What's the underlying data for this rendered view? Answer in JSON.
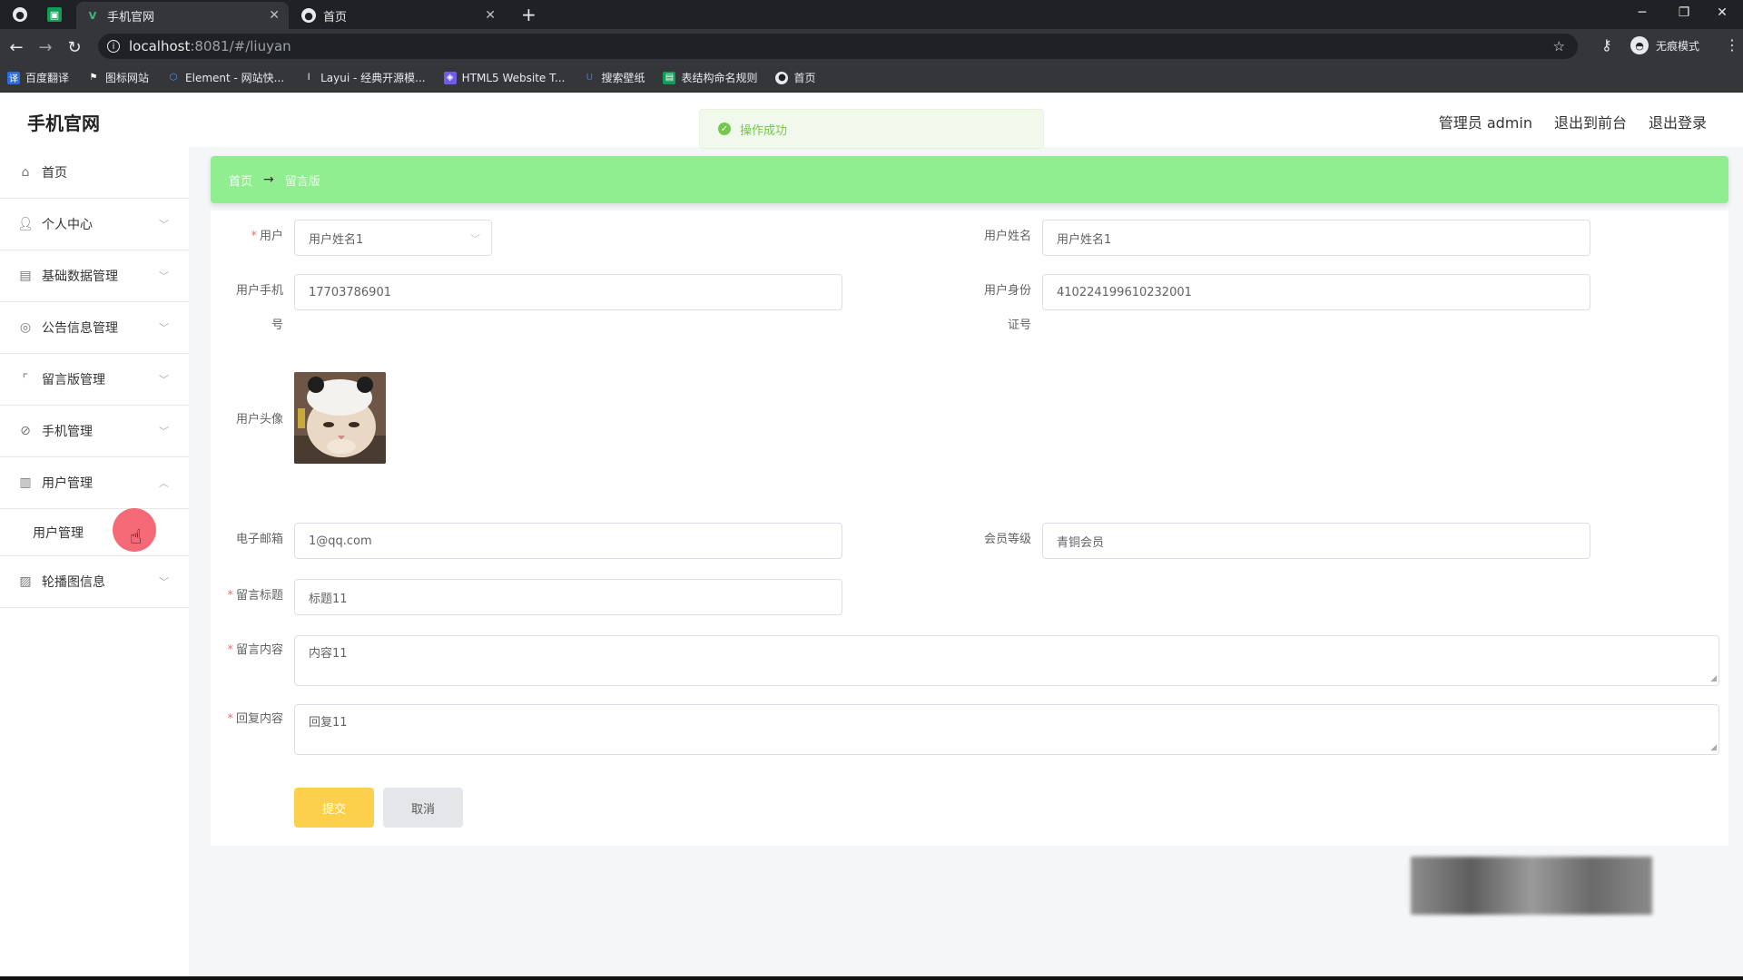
{
  "browser": {
    "tabs": [
      {
        "title": "手机官网",
        "active": true
      },
      {
        "title": "首页",
        "active": false
      }
    ],
    "new_tab": "+",
    "url_host": "localhost",
    "url_path": ":8081/#/liuyan",
    "incognito_label": "无痕模式",
    "bookmarks": [
      {
        "label": "百度翻译",
        "icon": "translate-icon",
        "color": "#2b6de5"
      },
      {
        "label": "图标网站",
        "icon": "flag-icon",
        "color": "#444444"
      },
      {
        "label": "Element - 网站快...",
        "icon": "element-icon",
        "color": "#409eff"
      },
      {
        "label": "Layui - 经典开源模...",
        "icon": "layui-icon",
        "color": "#555555"
      },
      {
        "label": "HTML5 Website T...",
        "icon": "html5-icon",
        "color": "#6c5ce7"
      },
      {
        "label": "搜索壁纸",
        "icon": "wallpaper-icon",
        "color": "#3a7bd5"
      },
      {
        "label": "表结构命名规则",
        "icon": "sheet-icon",
        "color": "#0f9d58"
      },
      {
        "label": "首页",
        "icon": "globe-icon",
        "color": "#777777"
      }
    ]
  },
  "app": {
    "brand": "手机官网",
    "top_links": [
      "管理员 admin",
      "退出到前台",
      "退出登录"
    ],
    "toast": "操作成功",
    "menu": [
      {
        "label": "首页",
        "icon": "home-icon",
        "has_chevron": false
      },
      {
        "label": "个人中心",
        "icon": "user-icon",
        "has_chevron": true
      },
      {
        "label": "基础数据管理",
        "icon": "clipboard-icon",
        "has_chevron": true
      },
      {
        "label": "公告信息管理",
        "icon": "target-icon",
        "has_chevron": true
      },
      {
        "label": "留言版管理",
        "icon": "crop-icon",
        "has_chevron": true
      },
      {
        "label": "手机管理",
        "icon": "compass-icon",
        "has_chevron": true
      },
      {
        "label": "用户管理",
        "icon": "bar-chart-icon",
        "has_chevron": true,
        "expanded": true
      },
      {
        "label": "轮播图信息",
        "icon": "picture-icon",
        "has_chevron": true
      }
    ],
    "submenu": {
      "label": "用户管理"
    },
    "breadcrumb": {
      "home": "首页",
      "current": "留言版"
    }
  },
  "form": {
    "user_label": "用户",
    "user_value": "用户姓名1",
    "user_name_label": "用户姓名",
    "user_name_value": "用户姓名1",
    "phone_label_1": "用户手机",
    "phone_label_2": "号",
    "phone_value": "17703786901",
    "id_label_1": "用户身份",
    "id_label_2": "证号",
    "id_value": "410224199610232001",
    "avatar_label": "用户头像",
    "email_label": "电子邮箱",
    "email_value": "1@qq.com",
    "level_label": "会员等级",
    "level_value": "青铜会员",
    "title_label": "留言标题",
    "title_value": "标题11",
    "content_label": "留言内容",
    "content_value": "内容11",
    "reply_label": "回复内容",
    "reply_value": "回复11",
    "submit": "提交",
    "cancel": "取消"
  },
  "colors": {
    "breadcrumb_bg": "#90ee90",
    "submit_bg": "#fcd04b",
    "required": "#f56c6c",
    "toast_green": "#67c23a"
  }
}
